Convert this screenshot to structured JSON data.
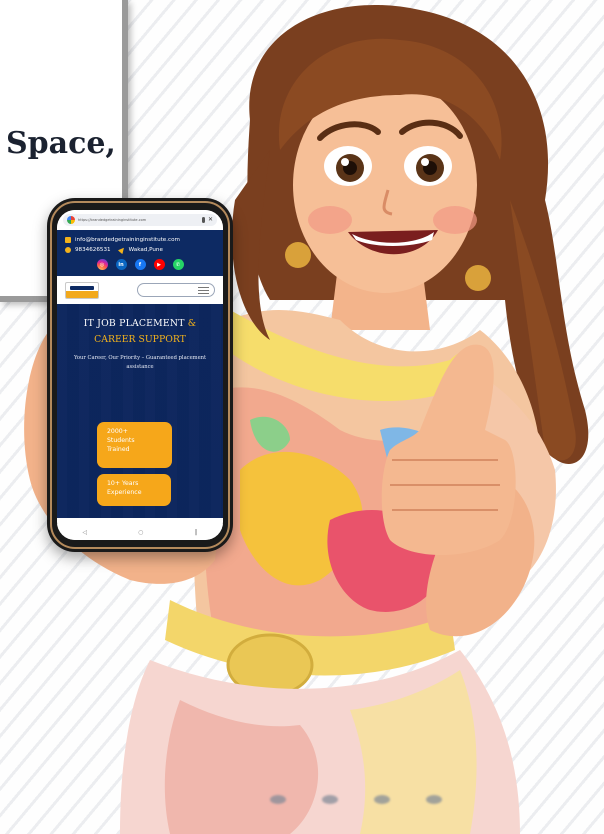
{
  "headline": {
    "fragment": "Space,"
  },
  "phone": {
    "browser": {
      "url": "https://brandedgetraininginstitute.com"
    },
    "contact": {
      "email": "info@brandedgetraininginstitute.com",
      "phone": "9834626531",
      "location": "Wakad,Pune"
    },
    "socials": [
      "instagram-icon",
      "linkedin-icon",
      "facebook-icon",
      "youtube-icon",
      "whatsapp-icon"
    ],
    "hero": {
      "title_line1": "IT JOB PLACEMENT",
      "title_amp": "&",
      "title_line2": "CAREER SUPPORT",
      "subtitle": "Your Career, Our Priority – Guaranteed placement assistance"
    },
    "stats": [
      {
        "line1": "2000+",
        "line2": "Students",
        "line3": "Trained"
      },
      {
        "line1": "10+ Years",
        "line2": "Experience"
      }
    ],
    "nav": {
      "back": "◁",
      "home": "○",
      "recent": "‖"
    }
  },
  "colors": {
    "navy": "#0d2a63",
    "accent": "#f2b21c",
    "stat_orange": "#f6a71a"
  }
}
